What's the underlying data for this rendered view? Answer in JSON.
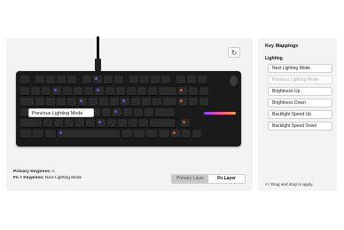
{
  "main": {
    "reset_icon": "refresh-icon",
    "tooltip_label": "Previous Lighting Mode",
    "primary_keypress_label": "Primary Keypress:",
    "primary_keypress_value": "A",
    "fn_keypress_label": "Fn + Keypress:",
    "fn_keypress_value": "Next Lighting Mode",
    "layers": [
      "Primary Layer",
      "Fn Layer"
    ],
    "active_layer": "Primary Layer"
  },
  "side": {
    "title": "Key Mappings",
    "group": "Lighting",
    "items": [
      {
        "label": "Next Lighting Mode",
        "disabled": false
      },
      {
        "label": "Previous Lighting Mode",
        "disabled": true
      },
      {
        "label": "Brightness Up",
        "disabled": false
      },
      {
        "label": "Brightness Down",
        "disabled": false
      },
      {
        "label": "Backlight Speed Up",
        "disabled": false
      },
      {
        "label": "Backlight Speed Down",
        "disabled": false
      }
    ],
    "hint": "<< Drag and drop to apply."
  },
  "colors": {
    "accent_purple": "#7a5bd6",
    "accent_orange": "#d86a3a",
    "panel_bg": "#f3f3f3"
  }
}
